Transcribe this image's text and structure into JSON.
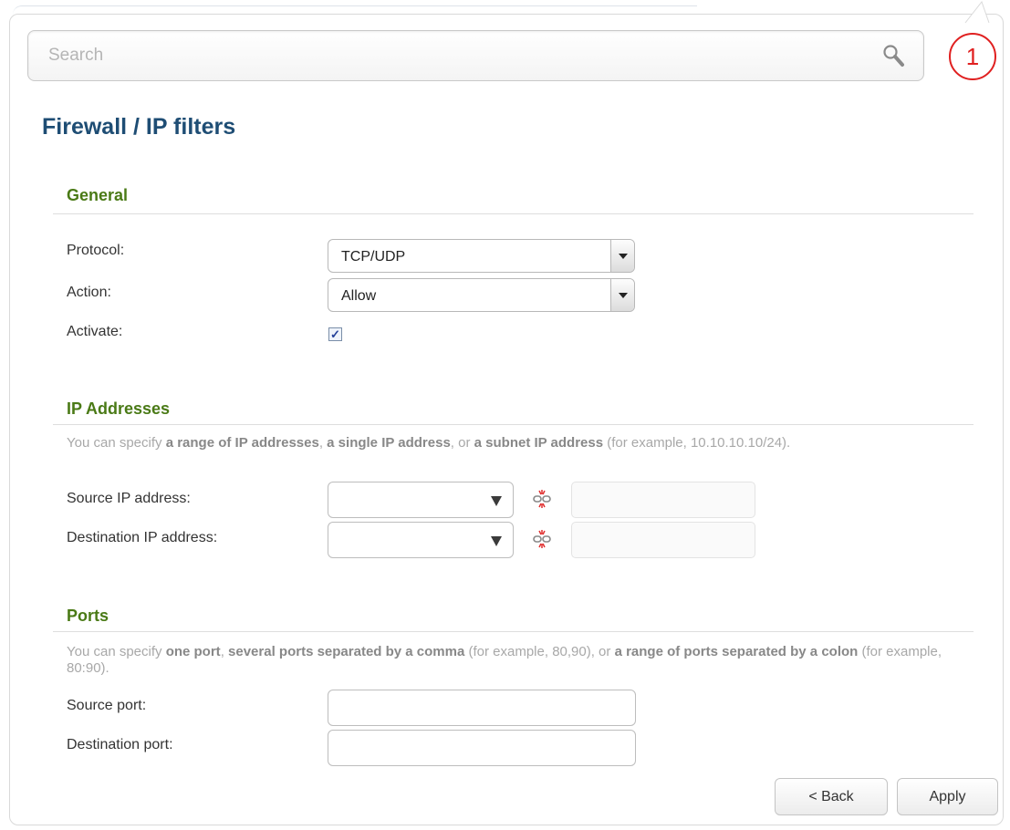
{
  "search": {
    "placeholder": "Search"
  },
  "notification": {
    "count": "1"
  },
  "page": {
    "title": "Firewall /  IP filters"
  },
  "general": {
    "title": "General",
    "protocol_label": "Protocol:",
    "protocol_value": "TCP/UDP",
    "action_label": "Action:",
    "action_value": "Allow",
    "activate_label": "Activate:",
    "activate_checked": true
  },
  "ip": {
    "title": "IP Addresses",
    "hint_parts": [
      "You can specify ",
      "a range of IP addresses",
      ", ",
      "a single IP address",
      ", or ",
      "a subnet IP address",
      " (for example, 10.10.10.10/24)."
    ],
    "source_label": "Source IP address:",
    "destination_label": "Destination IP address:"
  },
  "ports": {
    "title": "Ports",
    "hint_parts": [
      "You can specify ",
      "one port",
      ", ",
      "several ports separated by a comma",
      " (for example, 80,90), or ",
      "a range of ports separated by a colon",
      " (for example, 80:90)."
    ],
    "source_label": "Source port:",
    "destination_label": "Destination port:"
  },
  "buttons": {
    "back": "< Back",
    "apply": "Apply"
  },
  "colors": {
    "accent_title": "#1e4d74",
    "section_title": "#4a7a16",
    "badge": "#e02020"
  }
}
